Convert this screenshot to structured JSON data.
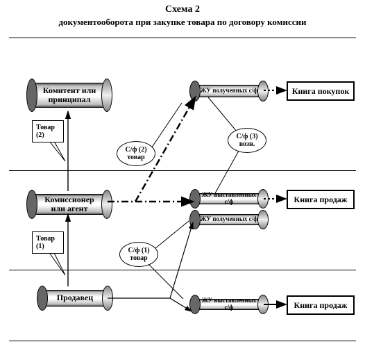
{
  "title": {
    "line1": "Схема 2",
    "line2": "документооборота при закупке товара по договору комиссии"
  },
  "entities": {
    "principal": "Комитент или принципал",
    "agent": "Комиссионер или агент",
    "seller": "Продавец"
  },
  "journals": {
    "received_top": "ЖУ полученных с/ф",
    "issued_mid": "ЖУ выставленных с/ф",
    "received_mid": "ЖУ полученных с/ф",
    "issued_bot": "ЖУ выставленных с/ф"
  },
  "books": {
    "purchases": "Книга покупок",
    "sales_mid": "Книга продаж",
    "sales_bot": "Книга продаж"
  },
  "callouts": {
    "goods1": "Товар (1)",
    "goods2": "Товар (2)",
    "sf1": "С/ф (1) товар",
    "sf2": "С/ф (2) товар",
    "sf3": "С/ф (3) возн."
  }
}
